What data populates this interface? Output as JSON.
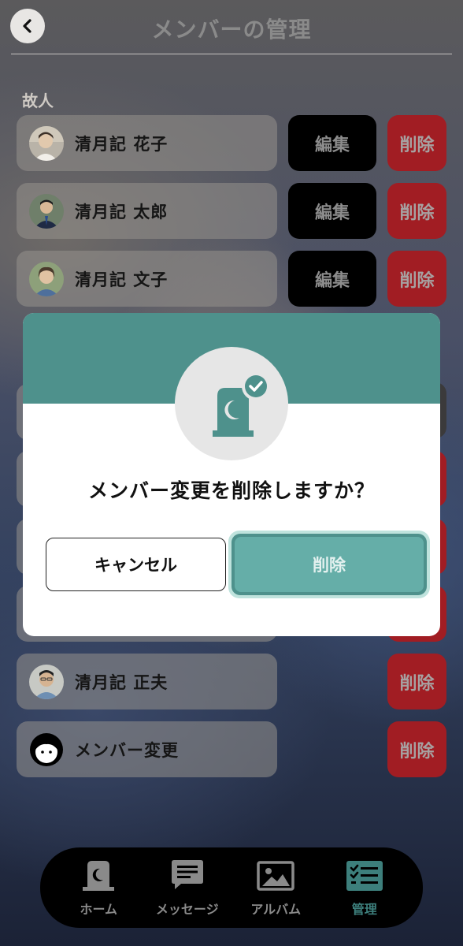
{
  "header": {
    "title": "メンバーの管理"
  },
  "section": {
    "label": "故人"
  },
  "members": [
    {
      "name": "清月記 花子",
      "edit": "編集",
      "delete": "削除"
    },
    {
      "name": "清月記 太郎",
      "edit": "編集",
      "delete": "削除"
    },
    {
      "name": "清月記 文子",
      "edit": "編集",
      "delete": "削除"
    },
    {
      "name": "清月記 正夫",
      "delete": "削除"
    },
    {
      "name": "メンバー変更",
      "delete": "削除"
    }
  ],
  "modal": {
    "question": "メンバー変更を削除しますか？",
    "cancel": "キャンセル",
    "confirm": "削除"
  },
  "tabs": [
    {
      "label": "ホーム",
      "icon": "gravestone-icon"
    },
    {
      "label": "メッセージ",
      "icon": "message-icon"
    },
    {
      "label": "アルバム",
      "icon": "album-icon"
    },
    {
      "label": "管理",
      "icon": "checklist-icon",
      "active": true
    }
  ],
  "colors": {
    "accent": "#4e918c",
    "delete": "#a11d23"
  }
}
